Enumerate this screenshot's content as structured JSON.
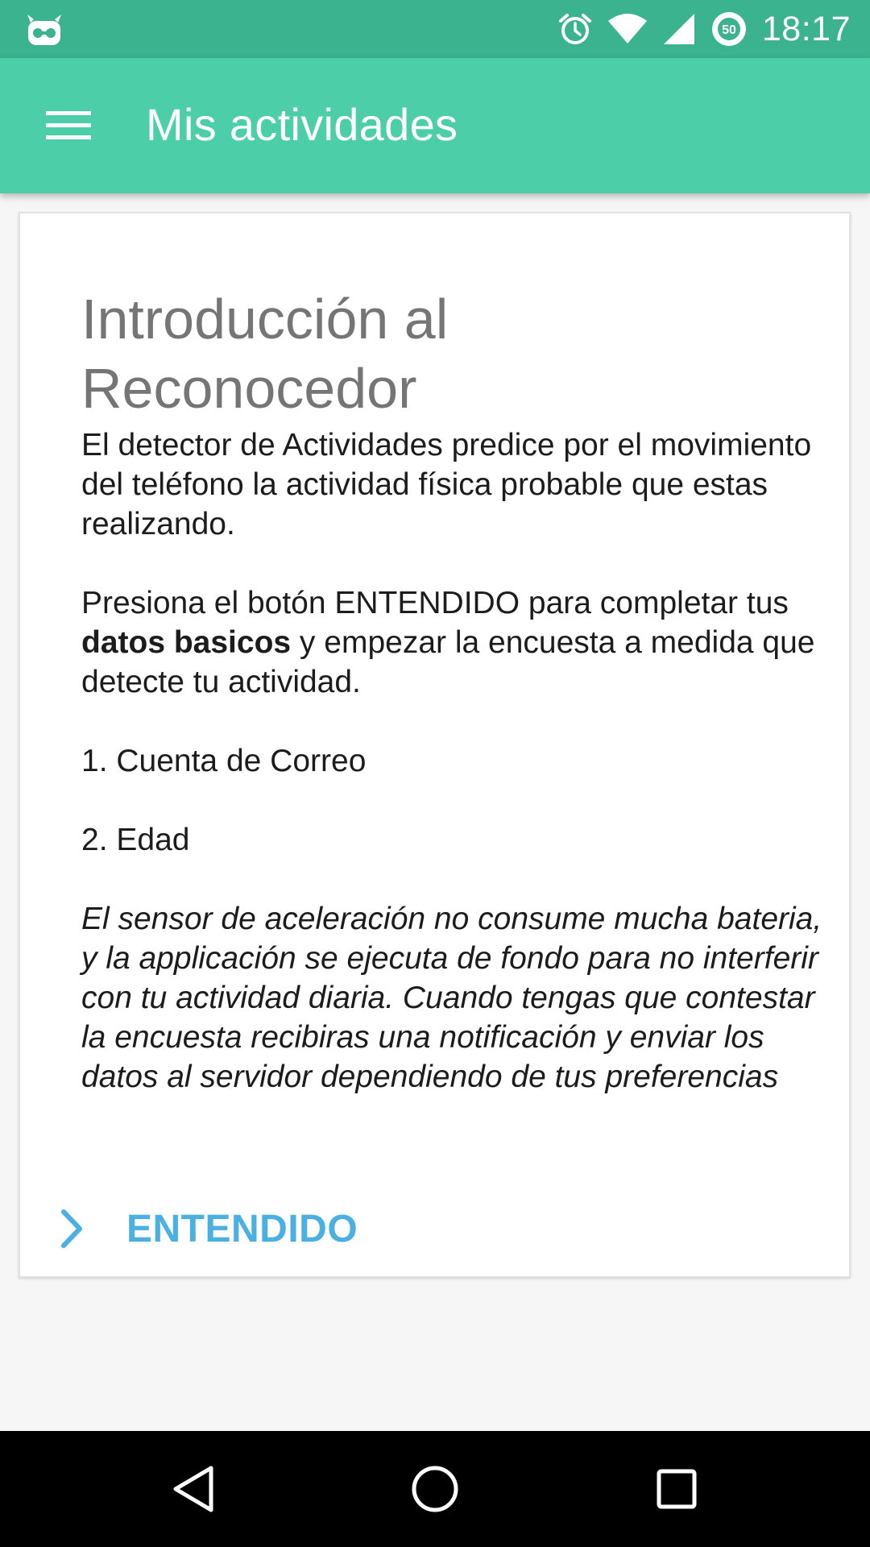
{
  "status_bar": {
    "time": "18:17",
    "data_saver_badge": "50",
    "background_color": "#3bb38f",
    "icons": [
      "cyanogen-robot-icon",
      "alarm-icon",
      "wifi-icon",
      "cell-signal-icon",
      "data-saver-icon"
    ]
  },
  "app_bar": {
    "title": "Mis actividades",
    "menu_icon": "hamburger-menu-icon",
    "background_color": "#4ccfa8"
  },
  "card": {
    "title_line1": "Introducción al",
    "title_line2": "Reconocedor",
    "paragraph1": "El detector de Actividades predice por el movimiento del teléfono la actividad física probable que estas realizando.",
    "paragraph2_before": "Presiona el botón ENTENDIDO para completar tus ",
    "paragraph2_bold": "datos basicos",
    "paragraph2_after": " y empezar la encuesta a medida que detecte tu actividad.",
    "list_item1": "1. Cuenta de Correo",
    "list_item2": "2. Edad",
    "note": "El sensor de aceleración no consume mucha bateria, y la applicación se ejecuta de fondo para no interferir con tu actividad diaria. Cuando tengas que contestar la encuesta recibiras una notificación y enviar los datos al servidor dependiendo de tus preferencias",
    "action_label": "ENTENDIDO",
    "action_icon": "chevron-right-icon",
    "action_color": "#4ab0e2"
  },
  "nav_bar": {
    "icons": [
      "back-icon",
      "home-icon",
      "recents-icon"
    ]
  }
}
